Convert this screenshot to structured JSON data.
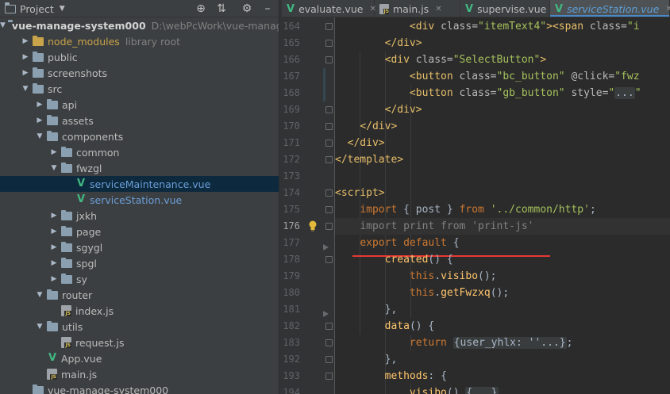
{
  "panel": {
    "title": "Project",
    "locate_icon": "crosshair-icon",
    "collapse_icon": "collapse-all-icon",
    "settings_icon": "gear-icon",
    "minimize_icon": "minimize-icon"
  },
  "tree": [
    {
      "label": "vue-manage-system000",
      "sub": "D:\\webPcWork\\vue-manag",
      "kind": "root",
      "indent": 0,
      "chev": "open"
    },
    {
      "label": "node_modules",
      "sub": "library root",
      "kind": "folder-yellow",
      "indent": 1,
      "chev": "closed"
    },
    {
      "label": "public",
      "kind": "folder",
      "indent": 1,
      "chev": "closed"
    },
    {
      "label": "screenshots",
      "kind": "folder",
      "indent": 1,
      "chev": "closed"
    },
    {
      "label": "src",
      "kind": "folder",
      "indent": 1,
      "chev": "open"
    },
    {
      "label": "api",
      "kind": "folder",
      "indent": 2,
      "chev": "closed"
    },
    {
      "label": "assets",
      "kind": "folder",
      "indent": 2,
      "chev": "closed"
    },
    {
      "label": "components",
      "kind": "folder",
      "indent": 2,
      "chev": "open"
    },
    {
      "label": "common",
      "kind": "folder",
      "indent": 3,
      "chev": "closed"
    },
    {
      "label": "fwzgl",
      "kind": "folder",
      "indent": 3,
      "chev": "open"
    },
    {
      "label": "serviceMaintenance.vue",
      "kind": "vue",
      "indent": 4,
      "chev": "none",
      "selected": true
    },
    {
      "label": "serviceStation.vue",
      "kind": "vue",
      "indent": 4,
      "chev": "none"
    },
    {
      "label": "jxkh",
      "kind": "folder",
      "indent": 3,
      "chev": "closed"
    },
    {
      "label": "page",
      "kind": "folder",
      "indent": 3,
      "chev": "closed"
    },
    {
      "label": "sgygl",
      "kind": "folder",
      "indent": 3,
      "chev": "closed"
    },
    {
      "label": "spgl",
      "kind": "folder",
      "indent": 3,
      "chev": "closed"
    },
    {
      "label": "sy",
      "kind": "folder",
      "indent": 3,
      "chev": "closed"
    },
    {
      "label": "router",
      "kind": "folder",
      "indent": 2,
      "chev": "open"
    },
    {
      "label": "index.js",
      "kind": "js",
      "indent": 3,
      "chev": "none"
    },
    {
      "label": "utils",
      "kind": "folder",
      "indent": 2,
      "chev": "open"
    },
    {
      "label": "request.js",
      "kind": "js",
      "indent": 3,
      "chev": "none"
    },
    {
      "label": "App.vue",
      "kind": "vue-plain",
      "indent": 2,
      "chev": "none"
    },
    {
      "label": "main.js",
      "kind": "js",
      "indent": 2,
      "chev": "none"
    },
    {
      "label": "vue-manage-system000",
      "kind": "folder",
      "indent": 1,
      "chev": "none"
    }
  ],
  "tabs": [
    {
      "label": "evaluate.vue",
      "icon": "vue-icon"
    },
    {
      "label": "main.js",
      "icon": "js-file-icon"
    },
    {
      "label": "supervise.vue",
      "icon": "vue-icon"
    },
    {
      "label": "serviceStation.vue",
      "icon": "vue-icon",
      "active": true
    }
  ],
  "editor": {
    "current_line": "176",
    "lines": [
      {
        "n": "164",
        "html": "            <span class='tag'>&lt;div</span> <span class='attr'>class=</span><span class='str'>\"itemText4\"</span><span class='tag'>&gt;&lt;span</span> <span class='attr'>class=</span><span class='str'>\"i</span>"
      },
      {
        "n": "165",
        "html": "        <span class='tag'>&lt;/div&gt;</span>"
      },
      {
        "n": "166",
        "html": "        <span class='tag'>&lt;div</span> <span class='attr'>class=</span><span class='str'>\"SelectButton\"</span><span class='tag'>&gt;</span>"
      },
      {
        "n": "167",
        "html": "            <span class='tag'>&lt;button</span> <span class='attr'>class=</span><span class='str'>\"bc_button\"</span> <span class='attr'>@click=</span><span class='str'>\"fwz</span>"
      },
      {
        "n": "168",
        "html": "            <span class='tag'>&lt;button</span> <span class='attr'>class=</span><span class='str'>\"gb_button\"</span> <span class='attr'>style=</span><span class='str'>\"<span class='fold-box'>...</span>\"</span>"
      },
      {
        "n": "169",
        "html": "        <span class='tag'>&lt;/div&gt;</span>"
      },
      {
        "n": "170",
        "html": "    <span class='tag'>&lt;/div&gt;</span>"
      },
      {
        "n": "171",
        "html": "<span class='tag'>  &lt;/div&gt;</span>"
      },
      {
        "n": "172",
        "html": "<span class='tag'>&lt;/template&gt;</span>"
      },
      {
        "n": "173",
        "html": ""
      },
      {
        "n": "174",
        "html": "<span class='tag'>&lt;script&gt;</span>"
      },
      {
        "n": "175",
        "html": "    <span class='kw'>import</span> { post } <span class='kw'>from</span> <span class='str'>'../common/http'</span>;"
      },
      {
        "n": "176",
        "html": "    <span class='dim'>import print from </span><span class='dim'>'print-js'</span>"
      },
      {
        "n": "177",
        "html": "    <span class='kw'>export default</span> {"
      },
      {
        "n": "178",
        "html": "        <span class='fn'>created</span>() {"
      },
      {
        "n": "179",
        "html": "            <span class='thisk'>this</span>.<span class='fn'>visibo</span>();"
      },
      {
        "n": "180",
        "html": "            <span class='thisk'>this</span>.<span class='fn'>getFwzxq</span>();"
      },
      {
        "n": "181",
        "html": "        },"
      },
      {
        "n": "182",
        "html": "        <span class='fn'>data</span>() {"
      },
      {
        "n": "183",
        "html": "            <span class='kw'>return</span> <span class='fold-box'>{user_yhlx: ''...}</span>;"
      },
      {
        "n": "192",
        "html": "        },"
      },
      {
        "n": "193",
        "html": "        <span class='fn'>methods</span>: {"
      },
      {
        "n": "194",
        "html": "            <span class='fn'>visibo</span>() <span class='fold-box'>{...}</span>"
      }
    ]
  },
  "colors": {
    "accent": "#4a88c7",
    "annotation": "#e53935",
    "vue": "#41b883"
  }
}
